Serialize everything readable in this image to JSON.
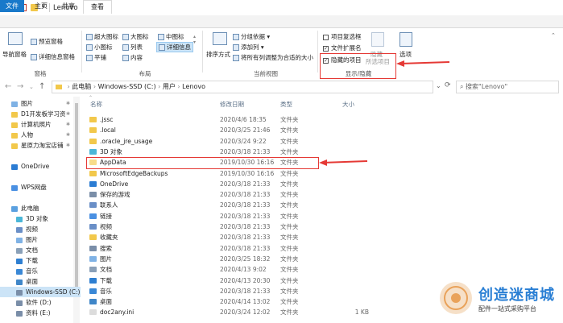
{
  "window": {
    "title": "Lenovo"
  },
  "tabs": [
    {
      "label": "文件"
    },
    {
      "label": "主页"
    },
    {
      "label": "共享"
    },
    {
      "label": "查看"
    }
  ],
  "ribbon": {
    "panes": {
      "nav_pane": "导航窗格",
      "preview_pane": "预览窗格",
      "details_pane": "详细信息窗格",
      "label": "窗格"
    },
    "layout": {
      "items": [
        "超大图标",
        "大图标",
        "中图标",
        "小图标",
        "列表",
        "详细信息",
        "平铺",
        "内容"
      ],
      "label": "布局"
    },
    "current_view": {
      "sort": "排序方式",
      "group_by": "分组依据",
      "add_column": "添加列",
      "fit_columns": "将所有列调整为合适的大小",
      "label": "当前视图"
    },
    "show_hide": {
      "item_checkbox": "项目复选框",
      "file_ext": "文件扩展名",
      "hidden_items": "隐藏的项目",
      "hide_btn": "隐藏",
      "selected_items": "所选项目",
      "options": "选项",
      "label": "显示/隐藏"
    }
  },
  "address": {
    "path": [
      "此电脑",
      "Windows-SSD (C:)",
      "用户",
      "Lenovo"
    ],
    "search_placeholder": "搜索\"Lenovo\""
  },
  "nav_items": [
    {
      "label": "图片",
      "color": "#7fb2e5",
      "pin": true
    },
    {
      "label": "D1开发板学习资",
      "color": "#f2c84b",
      "pin": true
    },
    {
      "label": "计算机照片",
      "color": "#f2c84b",
      "pin": true
    },
    {
      "label": "人物",
      "color": "#f2c84b",
      "pin": true
    },
    {
      "label": "星原力淘宝店铺",
      "color": "#f2c84b",
      "pin": true
    },
    {
      "label": "",
      "color": "",
      "pin": false
    },
    {
      "label": "OneDrive",
      "color": "#2b7cd3",
      "pin": false
    },
    {
      "label": "",
      "color": "",
      "pin": false
    },
    {
      "label": "WPS网盘",
      "color": "#4a90e2",
      "pin": false
    },
    {
      "label": "",
      "color": "",
      "pin": false
    },
    {
      "label": "此电脑",
      "color": "#5aa0e0",
      "pin": false
    },
    {
      "label": "3D 对象",
      "color": "#4ab6d8",
      "pin": false
    },
    {
      "label": "视频",
      "color": "#6a8fc7",
      "pin": false
    },
    {
      "label": "图片",
      "color": "#7fb2e5",
      "pin": false
    },
    {
      "label": "文档",
      "color": "#8aa0b8",
      "pin": false
    },
    {
      "label": "下载",
      "color": "#2f7fd1",
      "pin": false
    },
    {
      "label": "音乐",
      "color": "#3a88d6",
      "pin": false
    },
    {
      "label": "桌面",
      "color": "#3f86c8",
      "pin": false
    },
    {
      "label": "Windows-SSD (C:)",
      "color": "#7a8ea8",
      "pin": false
    },
    {
      "label": "软件 (D:)",
      "color": "#7a8ea8",
      "pin": false
    },
    {
      "label": "资料 (E:)",
      "color": "#7a8ea8",
      "pin": false
    }
  ],
  "columns": {
    "name": "名称",
    "date": "修改日期",
    "type": "类型",
    "size": "大小"
  },
  "files": [
    {
      "name": ".jssc",
      "date": "2020/4/6 18:35",
      "type": "文件夹",
      "size": "",
      "color": "#f2c84b"
    },
    {
      "name": ".local",
      "date": "2020/3/25 21:46",
      "type": "文件夹",
      "size": "",
      "color": "#f2c84b"
    },
    {
      "name": ".oracle_jre_usage",
      "date": "2020/3/24 9:22",
      "type": "文件夹",
      "size": "",
      "color": "#f2c84b"
    },
    {
      "name": "3D 对象",
      "date": "2020/3/18 21:33",
      "type": "文件夹",
      "size": "",
      "color": "#4ab6d8"
    },
    {
      "name": "AppData",
      "date": "2019/10/30 16:16",
      "type": "文件夹",
      "size": "",
      "color": "#f7dc8a"
    },
    {
      "name": "MicrosoftEdgeBackups",
      "date": "2019/10/30 16:16",
      "type": "文件夹",
      "size": "",
      "color": "#f2c84b"
    },
    {
      "name": "OneDrive",
      "date": "2020/3/18 21:33",
      "type": "文件夹",
      "size": "",
      "color": "#2b7cd3"
    },
    {
      "name": "保存的游戏",
      "date": "2020/3/18 21:33",
      "type": "文件夹",
      "size": "",
      "color": "#7a8ea8"
    },
    {
      "name": "联系人",
      "date": "2020/3/18 21:33",
      "type": "文件夹",
      "size": "",
      "color": "#6a8fc7"
    },
    {
      "name": "链接",
      "date": "2020/3/18 21:33",
      "type": "文件夹",
      "size": "",
      "color": "#4a90e2"
    },
    {
      "name": "视频",
      "date": "2020/3/18 21:33",
      "type": "文件夹",
      "size": "",
      "color": "#6a8fc7"
    },
    {
      "name": "收藏夹",
      "date": "2020/3/18 21:33",
      "type": "文件夹",
      "size": "",
      "color": "#f2c84b"
    },
    {
      "name": "搜索",
      "date": "2020/3/18 21:33",
      "type": "文件夹",
      "size": "",
      "color": "#7a8ea8"
    },
    {
      "name": "图片",
      "date": "2020/3/25 18:32",
      "type": "文件夹",
      "size": "",
      "color": "#7fb2e5"
    },
    {
      "name": "文档",
      "date": "2020/4/13 9:02",
      "type": "文件夹",
      "size": "",
      "color": "#8aa0b8"
    },
    {
      "name": "下载",
      "date": "2020/4/13 20:30",
      "type": "文件夹",
      "size": "",
      "color": "#2f7fd1"
    },
    {
      "name": "音乐",
      "date": "2020/3/18 21:33",
      "type": "文件夹",
      "size": "",
      "color": "#3a88d6"
    },
    {
      "name": "桌面",
      "date": "2020/4/14 13:02",
      "type": "文件夹",
      "size": "",
      "color": "#3f86c8"
    },
    {
      "name": "doc2any.ini",
      "date": "2020/3/24 12:02",
      "type": "文件夹",
      "size": "1 KB",
      "color": "#dcdcdc"
    }
  ],
  "watermark": {
    "title": "创造迷商城",
    "subtitle": "配件一站式采购平台"
  }
}
